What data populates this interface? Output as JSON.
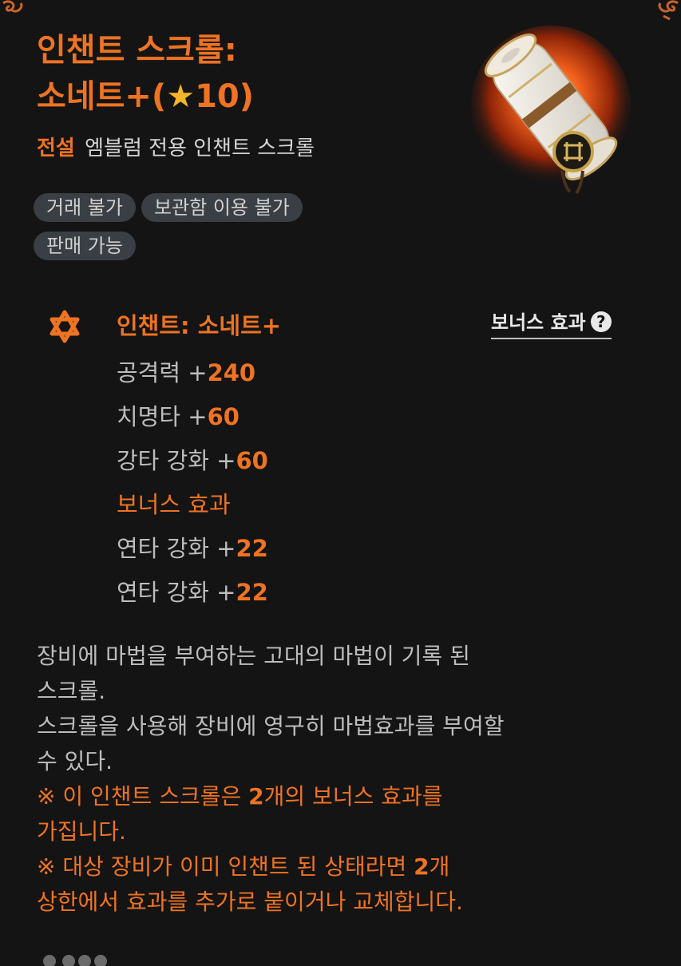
{
  "item": {
    "title_line1": "인챈트 스크롤:",
    "title_line2_prefix": "소네트+(",
    "title_star": "★",
    "title_line2_level": "10",
    "title_line2_suffix": ")",
    "grade": "전설",
    "type": "엠블럼 전용 인챈트 스크롤",
    "icon": "scroll-icon"
  },
  "tags": [
    "거래 불가",
    "보관함 이용 불가",
    "판매 가능"
  ],
  "enchant": {
    "icon": "star-of-david-icon",
    "name": "인챈트: 소네트+",
    "bonus_link": "보너스 효과",
    "help_symbol": "?"
  },
  "stats": [
    {
      "label": "공격력 +",
      "value": "240"
    },
    {
      "label": "치명타 +",
      "value": "60"
    },
    {
      "label": "강타 강화 +",
      "value": "60"
    }
  ],
  "bonus": {
    "header": "보너스 효과",
    "stats": [
      {
        "label": "연타 강화 +",
        "value": "22"
      },
      {
        "label": "연타 강화 +",
        "value": "22"
      }
    ]
  },
  "description": {
    "line1": "장비에 마법을 부여하는 고대의 마법이 기록 된",
    "line2": "스크롤.",
    "line3": "스크롤을 사용해 장비에 영구히 마법효과를 부여할",
    "line4": "수 있다.",
    "note1_pre": "※ 이 인챈트 스크롤은 ",
    "note1_num": "2",
    "note1_post": "개의 보너스 효과를",
    "note1_line2": "가집니다.",
    "note2_pre": "※ 대상 장비가 이미 인챈트 된 상태라면 ",
    "note2_num": "2",
    "note2_post": "개",
    "note2_line2": "상한에서 효과를 추가로 붙이거나 교체합니다."
  },
  "colors": {
    "accent": "#ee7322",
    "background": "#141414",
    "tag_bg": "#3a3e45",
    "text": "#bdbdbd",
    "star": "#f3b62a"
  }
}
